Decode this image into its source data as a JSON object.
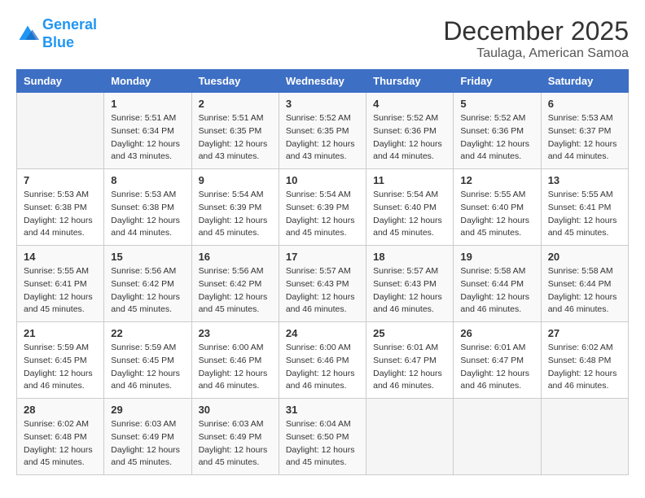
{
  "logo": {
    "line1": "General",
    "line2": "Blue"
  },
  "title": "December 2025",
  "subtitle": "Taulaga, American Samoa",
  "weekdays": [
    "Sunday",
    "Monday",
    "Tuesday",
    "Wednesday",
    "Thursday",
    "Friday",
    "Saturday"
  ],
  "weeks": [
    [
      {
        "day": "",
        "info": ""
      },
      {
        "day": "1",
        "info": "Sunrise: 5:51 AM\nSunset: 6:34 PM\nDaylight: 12 hours\nand 43 minutes."
      },
      {
        "day": "2",
        "info": "Sunrise: 5:51 AM\nSunset: 6:35 PM\nDaylight: 12 hours\nand 43 minutes."
      },
      {
        "day": "3",
        "info": "Sunrise: 5:52 AM\nSunset: 6:35 PM\nDaylight: 12 hours\nand 43 minutes."
      },
      {
        "day": "4",
        "info": "Sunrise: 5:52 AM\nSunset: 6:36 PM\nDaylight: 12 hours\nand 44 minutes."
      },
      {
        "day": "5",
        "info": "Sunrise: 5:52 AM\nSunset: 6:36 PM\nDaylight: 12 hours\nand 44 minutes."
      },
      {
        "day": "6",
        "info": "Sunrise: 5:53 AM\nSunset: 6:37 PM\nDaylight: 12 hours\nand 44 minutes."
      }
    ],
    [
      {
        "day": "7",
        "info": "Sunrise: 5:53 AM\nSunset: 6:38 PM\nDaylight: 12 hours\nand 44 minutes."
      },
      {
        "day": "8",
        "info": "Sunrise: 5:53 AM\nSunset: 6:38 PM\nDaylight: 12 hours\nand 44 minutes."
      },
      {
        "day": "9",
        "info": "Sunrise: 5:54 AM\nSunset: 6:39 PM\nDaylight: 12 hours\nand 45 minutes."
      },
      {
        "day": "10",
        "info": "Sunrise: 5:54 AM\nSunset: 6:39 PM\nDaylight: 12 hours\nand 45 minutes."
      },
      {
        "day": "11",
        "info": "Sunrise: 5:54 AM\nSunset: 6:40 PM\nDaylight: 12 hours\nand 45 minutes."
      },
      {
        "day": "12",
        "info": "Sunrise: 5:55 AM\nSunset: 6:40 PM\nDaylight: 12 hours\nand 45 minutes."
      },
      {
        "day": "13",
        "info": "Sunrise: 5:55 AM\nSunset: 6:41 PM\nDaylight: 12 hours\nand 45 minutes."
      }
    ],
    [
      {
        "day": "14",
        "info": "Sunrise: 5:55 AM\nSunset: 6:41 PM\nDaylight: 12 hours\nand 45 minutes."
      },
      {
        "day": "15",
        "info": "Sunrise: 5:56 AM\nSunset: 6:42 PM\nDaylight: 12 hours\nand 45 minutes."
      },
      {
        "day": "16",
        "info": "Sunrise: 5:56 AM\nSunset: 6:42 PM\nDaylight: 12 hours\nand 45 minutes."
      },
      {
        "day": "17",
        "info": "Sunrise: 5:57 AM\nSunset: 6:43 PM\nDaylight: 12 hours\nand 46 minutes."
      },
      {
        "day": "18",
        "info": "Sunrise: 5:57 AM\nSunset: 6:43 PM\nDaylight: 12 hours\nand 46 minutes."
      },
      {
        "day": "19",
        "info": "Sunrise: 5:58 AM\nSunset: 6:44 PM\nDaylight: 12 hours\nand 46 minutes."
      },
      {
        "day": "20",
        "info": "Sunrise: 5:58 AM\nSunset: 6:44 PM\nDaylight: 12 hours\nand 46 minutes."
      }
    ],
    [
      {
        "day": "21",
        "info": "Sunrise: 5:59 AM\nSunset: 6:45 PM\nDaylight: 12 hours\nand 46 minutes."
      },
      {
        "day": "22",
        "info": "Sunrise: 5:59 AM\nSunset: 6:45 PM\nDaylight: 12 hours\nand 46 minutes."
      },
      {
        "day": "23",
        "info": "Sunrise: 6:00 AM\nSunset: 6:46 PM\nDaylight: 12 hours\nand 46 minutes."
      },
      {
        "day": "24",
        "info": "Sunrise: 6:00 AM\nSunset: 6:46 PM\nDaylight: 12 hours\nand 46 minutes."
      },
      {
        "day": "25",
        "info": "Sunrise: 6:01 AM\nSunset: 6:47 PM\nDaylight: 12 hours\nand 46 minutes."
      },
      {
        "day": "26",
        "info": "Sunrise: 6:01 AM\nSunset: 6:47 PM\nDaylight: 12 hours\nand 46 minutes."
      },
      {
        "day": "27",
        "info": "Sunrise: 6:02 AM\nSunset: 6:48 PM\nDaylight: 12 hours\nand 46 minutes."
      }
    ],
    [
      {
        "day": "28",
        "info": "Sunrise: 6:02 AM\nSunset: 6:48 PM\nDaylight: 12 hours\nand 45 minutes."
      },
      {
        "day": "29",
        "info": "Sunrise: 6:03 AM\nSunset: 6:49 PM\nDaylight: 12 hours\nand 45 minutes."
      },
      {
        "day": "30",
        "info": "Sunrise: 6:03 AM\nSunset: 6:49 PM\nDaylight: 12 hours\nand 45 minutes."
      },
      {
        "day": "31",
        "info": "Sunrise: 6:04 AM\nSunset: 6:50 PM\nDaylight: 12 hours\nand 45 minutes."
      },
      {
        "day": "",
        "info": ""
      },
      {
        "day": "",
        "info": ""
      },
      {
        "day": "",
        "info": ""
      }
    ]
  ]
}
